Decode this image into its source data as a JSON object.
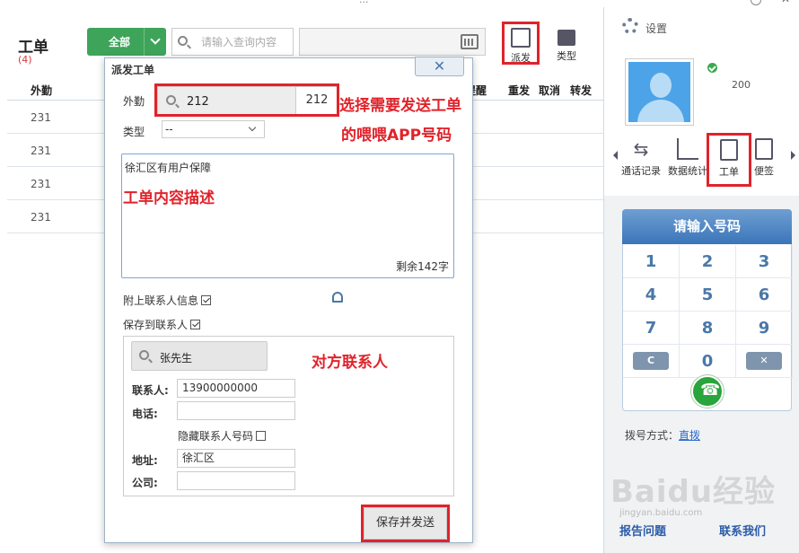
{
  "window": {
    "title_fragment": "...",
    "help": "?",
    "close": "✕"
  },
  "toolbar": {
    "title": "工单",
    "count": "(4)",
    "filter_label": "全部",
    "search_placeholder": "请输入查询内容",
    "dispatch_label": "派发",
    "type_label": "类型"
  },
  "table": {
    "columns": [
      "外勤",
      "提醒",
      "重发",
      "取消",
      "转发"
    ],
    "rows": [
      {
        "ext": "231"
      },
      {
        "ext": "231"
      },
      {
        "ext": "231"
      },
      {
        "ext": "231"
      }
    ]
  },
  "dialog": {
    "title": "派发工单",
    "close": "✕",
    "ext_label": "外勤",
    "ext_value": "212",
    "ext_side": "212",
    "type_label": "类型",
    "type_value": "--",
    "content_text": "徐汇区有用户保障",
    "remaining": "剩余142字",
    "attach_label": "附上联系人信息",
    "attach_checked": true,
    "save_contact_label": "保存到联系人",
    "save_contact_checked": true,
    "contact_search_value": "张先生",
    "contact_label": "联系人:",
    "contact_value": "13900000000",
    "phone_label": "电话:",
    "phone_value": "",
    "hide_label": "隐藏联系人号码",
    "hide_checked": false,
    "address_label": "地址:",
    "address_value": "徐汇区",
    "company_label": "公司:",
    "company_value": "",
    "save_send": "保存并发送"
  },
  "annotations": {
    "select_app": "选择需要发送工单",
    "select_app2": "的喂喂APP号码",
    "content_desc": "工单内容描述",
    "other_contact": "对方联系人"
  },
  "side": {
    "settings": "设置",
    "extension": "200",
    "nav": [
      "通话记录",
      "数据统计",
      "工单",
      "便签"
    ],
    "dial_header": "请输入号码",
    "keys": [
      "1",
      "2",
      "3",
      "4",
      "5",
      "6",
      "7",
      "8",
      "9",
      "C",
      "0",
      "✕"
    ],
    "dial_mode_label": "拨号方式：",
    "dial_mode_value": "直拨",
    "report": "报告问题",
    "contact_us": "联系我们"
  },
  "watermark": {
    "main": "Baidu经验",
    "sub": "jingyan.baidu.com"
  },
  "colors": {
    "accent_red": "#e0232b",
    "green": "#3ea45a",
    "blue_header": "#3a75b9"
  }
}
